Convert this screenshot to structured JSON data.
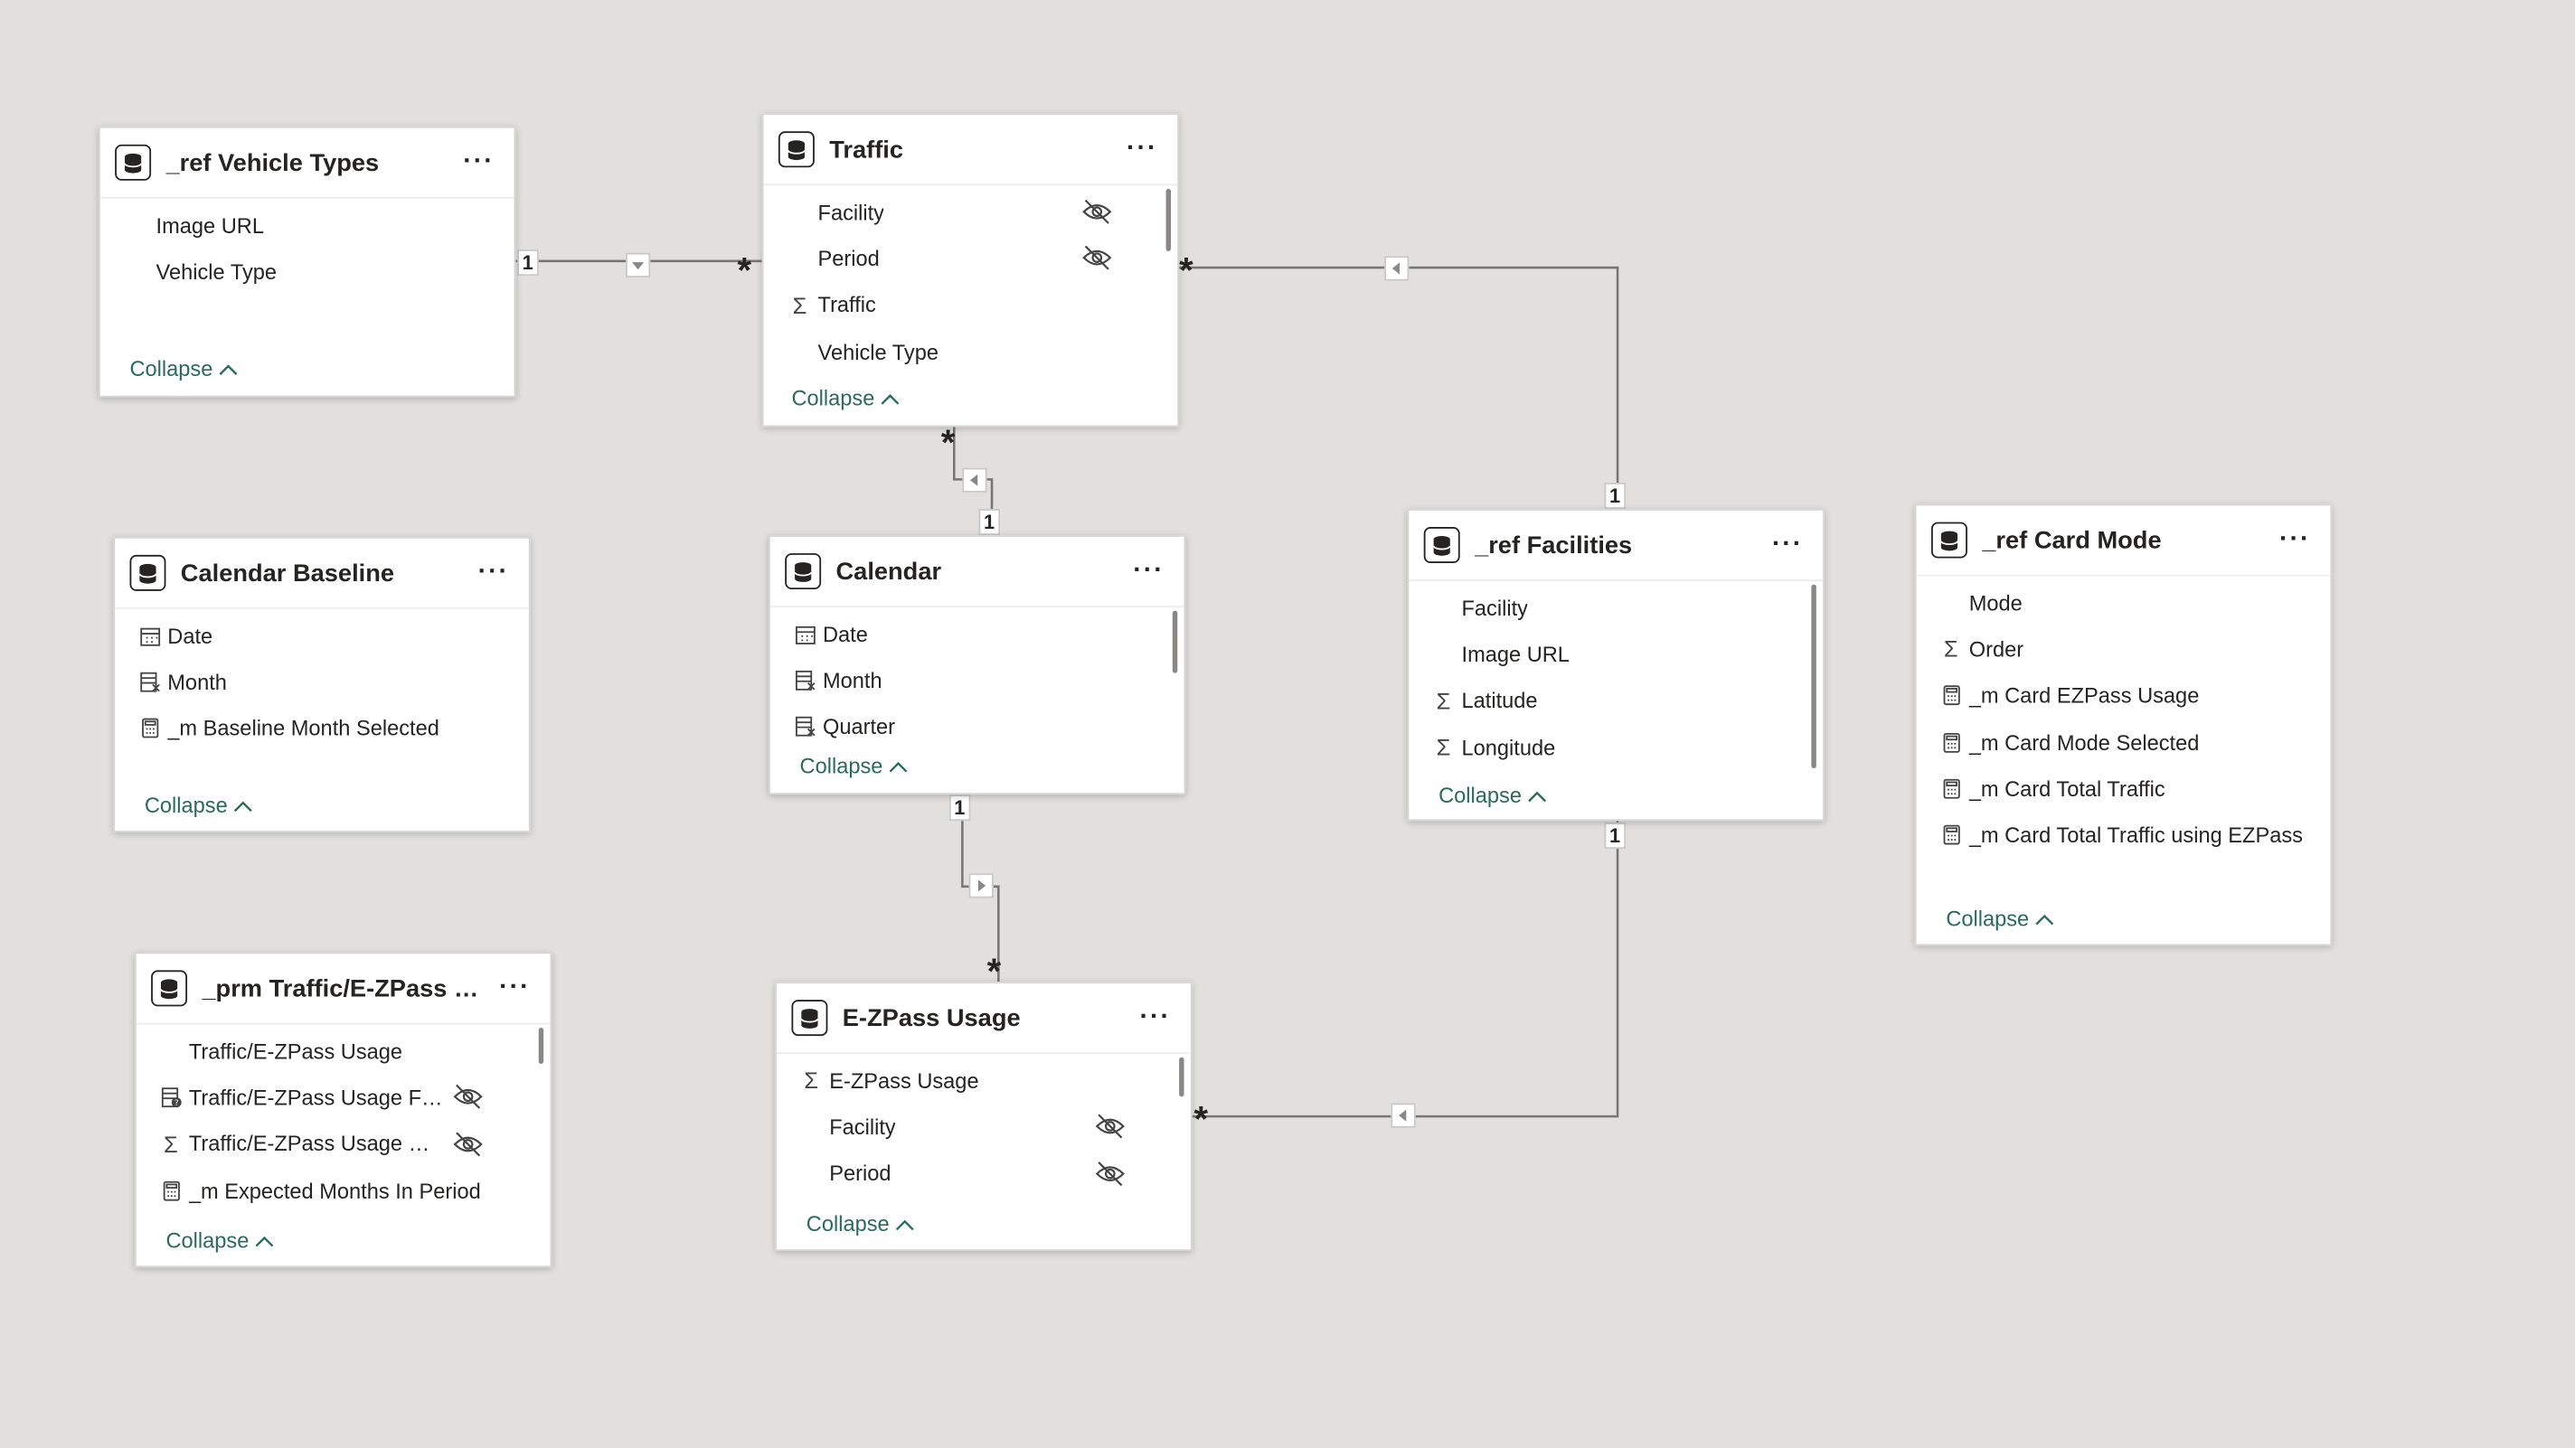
{
  "tables": {
    "vehicle_types": {
      "title": "_ref Vehicle Types",
      "fields": [
        "Image URL",
        "Vehicle Type"
      ],
      "collapse": "Collapse"
    },
    "traffic": {
      "title": "Traffic",
      "fields": [
        "Facility",
        "Period",
        "Traffic",
        "Vehicle Type"
      ],
      "collapse": "Collapse"
    },
    "calendar_baseline": {
      "title": "Calendar Baseline",
      "fields": [
        "Date",
        "Month",
        "_m Baseline Month Selected"
      ],
      "collapse": "Collapse"
    },
    "calendar": {
      "title": "Calendar",
      "fields": [
        "Date",
        "Month",
        "Quarter"
      ],
      "collapse": "Collapse"
    },
    "facilities": {
      "title": "_ref Facilities",
      "fields": [
        "Facility",
        "Image URL",
        "Latitude",
        "Longitude"
      ],
      "collapse": "Collapse"
    },
    "card_mode": {
      "title": "_ref Card Mode",
      "fields": [
        "Mode",
        "Order",
        "_m Card EZPass Usage",
        "_m Card Mode Selected",
        "_m Card Total Traffic",
        "_m Card Total Traffic using EZPass"
      ],
      "collapse": "Collapse"
    },
    "prm_traffic": {
      "title": "_prm Traffic/E-ZPass Us...",
      "fields": [
        "Traffic/E-ZPass Usage",
        "Traffic/E-ZPass Usage Fie...",
        "Traffic/E-ZPass Usage Or...",
        "_m Expected Months In Period"
      ],
      "collapse": "Collapse"
    },
    "ezpass": {
      "title": "E-ZPass Usage",
      "fields": [
        "E-ZPass Usage",
        "Facility",
        "Period"
      ],
      "collapse": "Collapse"
    }
  },
  "more_glyph": "···",
  "relationships": {
    "one": "1",
    "many": "*"
  }
}
